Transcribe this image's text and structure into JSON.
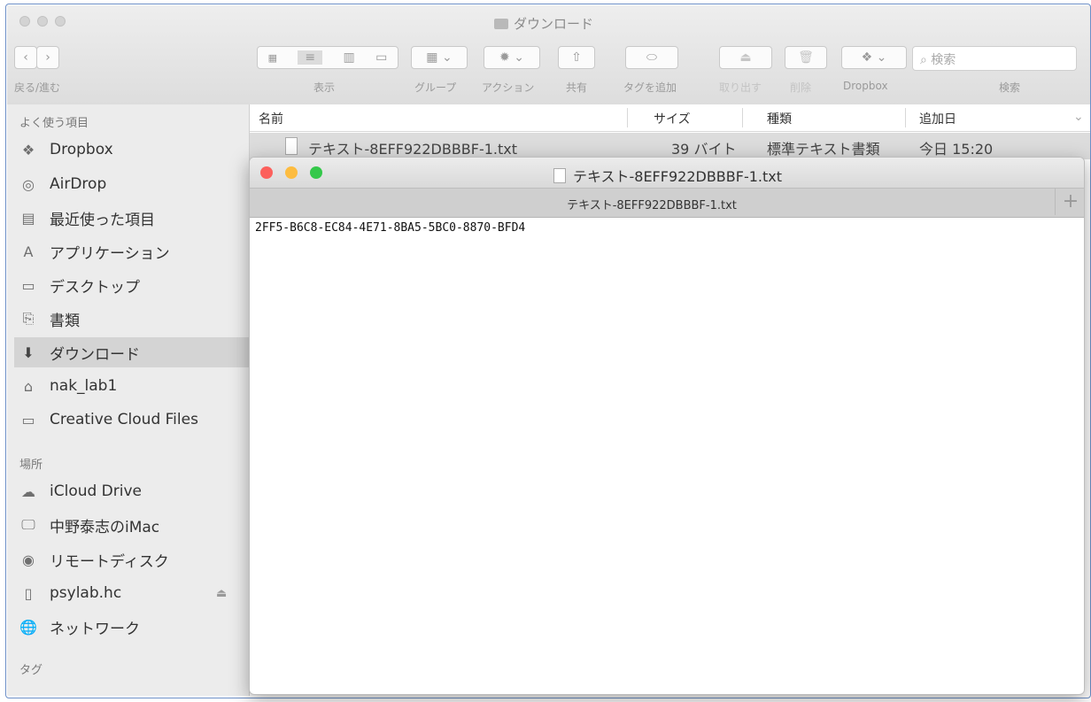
{
  "finder": {
    "title": "ダウンロード",
    "toolbar": {
      "back_forward_label": "戻る/進む",
      "view_label": "表示",
      "group_label": "グループ",
      "action_label": "アクション",
      "share_label": "共有",
      "tag_label": "タグを追加",
      "eject_label": "取り出す",
      "delete_label": "削除",
      "dropbox_label": "Dropbox",
      "search_label": "検索",
      "search_placeholder": "検索"
    },
    "sidebar": {
      "favorites_header": "よく使う項目",
      "favorites": [
        {
          "label": "Dropbox",
          "icon": "dropbox-icon"
        },
        {
          "label": "AirDrop",
          "icon": "airdrop-icon"
        },
        {
          "label": "最近使った項目",
          "icon": "recents-icon"
        },
        {
          "label": "アプリケーション",
          "icon": "applications-icon"
        },
        {
          "label": "デスクトップ",
          "icon": "desktop-icon"
        },
        {
          "label": "書類",
          "icon": "documents-icon"
        },
        {
          "label": "ダウンロード",
          "icon": "downloads-icon",
          "selected": true
        },
        {
          "label": "nak_lab1",
          "icon": "home-icon"
        },
        {
          "label": "Creative Cloud Files",
          "icon": "folder-icon"
        }
      ],
      "locations_header": "場所",
      "locations": [
        {
          "label": "iCloud Drive",
          "icon": "cloud-icon"
        },
        {
          "label": "中野泰志のiMac",
          "icon": "imac-icon"
        },
        {
          "label": "リモートディスク",
          "icon": "disc-icon"
        },
        {
          "label": "psylab.hc",
          "icon": "drive-icon"
        },
        {
          "label": "ネットワーク",
          "icon": "network-icon"
        }
      ],
      "tags_header": "タグ"
    },
    "columns": {
      "name": "名前",
      "size": "サイズ",
      "kind": "種類",
      "date_added": "追加日"
    },
    "rows": [
      {
        "name": "テキスト-8EFF922DBBBF-1.txt",
        "size": "39 バイト",
        "kind": "標準テキスト書類",
        "date_added": "今日 15:20"
      }
    ]
  },
  "textedit": {
    "title": "テキスト-8EFF922DBBBF-1.txt",
    "tab_title": "テキスト-8EFF922DBBBF-1.txt",
    "plus_label": "+",
    "content": "2FF5-B6C8-EC84-4E71-8BA5-5BC0-8870-BFD4"
  },
  "colors": {
    "close": "#fc605c",
    "minimize": "#fdbc40",
    "zoom": "#34c84a",
    "selected_row": "#dcdcdc"
  }
}
